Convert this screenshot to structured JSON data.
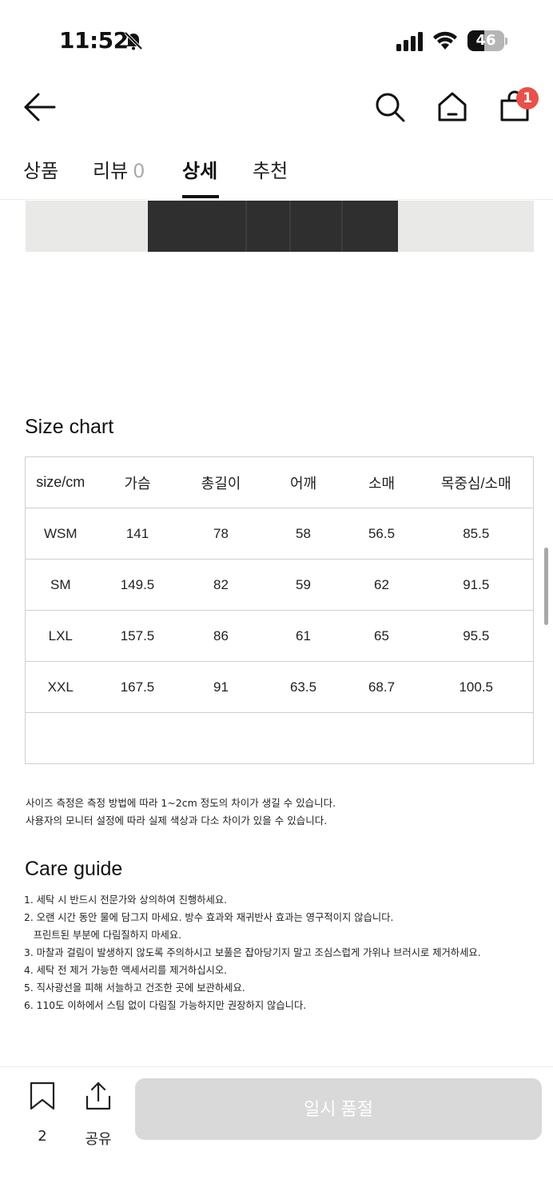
{
  "status_bar": {
    "time": "11:52",
    "battery_level": "46",
    "battery_fraction": 0.46
  },
  "header": {
    "icons": [
      "back-arrow-icon",
      "search-icon",
      "home-icon",
      "cart-icon"
    ],
    "cart_count": "1"
  },
  "tabs": [
    {
      "label": "상품"
    },
    {
      "label": "리뷰",
      "count": "0"
    },
    {
      "label": "상세",
      "active": true
    },
    {
      "label": "추천"
    }
  ],
  "size_chart": {
    "title": "Size chart",
    "headers": [
      "size/cm",
      "가슴",
      "총길이",
      "어깨",
      "소매",
      "목중심/소매"
    ],
    "rows": [
      [
        "WSM",
        "141",
        "78",
        "58",
        "56.5",
        "85.5"
      ],
      [
        "SM",
        "149.5",
        "82",
        "59",
        "62",
        "91.5"
      ],
      [
        "LXL",
        "157.5",
        "86",
        "61",
        "65",
        "95.5"
      ],
      [
        "XXL",
        "167.5",
        "91",
        "63.5",
        "68.7",
        "100.5"
      ]
    ]
  },
  "notes": [
    "사이즈 측정은 측정 방법에 따라 1~2cm 정도의 차이가 생길 수 있습니다.",
    "사용자의 모니터 설정에 따라 실제 색상과 다소 차이가 있을 수 있습니다."
  ],
  "care_guide": {
    "title": "Care guide",
    "items": [
      "1. 세탁 시 반드시 전문가와 상의하여 진행하세요.",
      "2. 오랜 시간 동안 물에 담그지 마세요. 방수 효과와 재귀반사 효과는 영구적이지 않습니다.",
      "   프린트된 부분에 다림질하지 마세요.",
      "3. 마찰과 걸림이 발생하지 않도록 주의하시고 보풀은 잡아당기지 말고 조심스럽게 가위나 브러시로 제거하세요.",
      "4. 세탁 전 제거 가능한 액세서리를 제거하십시오.",
      "5. 직사광선을 피해 서늘하고 건조한 곳에 보관하세요.",
      "6. 110도 이하에서 스팀 없이 다림질 가능하지만 권장하지 않습니다."
    ]
  },
  "bottom_bar": {
    "bookmark_count": "2",
    "share_label": "공유",
    "soldout_label": "일시 품절"
  },
  "colors": {
    "badge": "#e8504a",
    "disabled_button": "#d9d9d9",
    "tab_underline": "#111111"
  }
}
